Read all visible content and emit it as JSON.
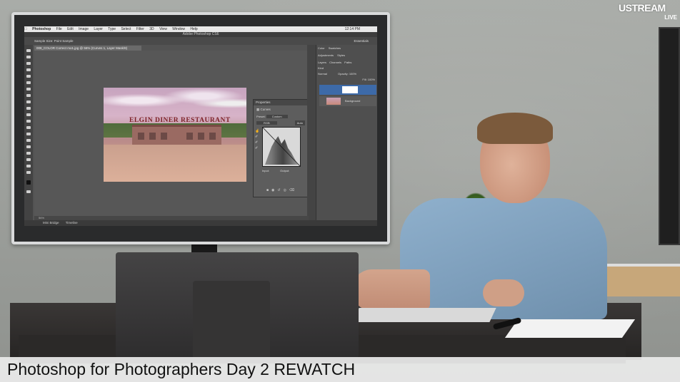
{
  "overlay": {
    "banner_title": "Photoshop for Photographers Day 2 REWATCH",
    "logo": {
      "name": "USTREAM",
      "sub": "LIVE"
    }
  },
  "photoshop": {
    "menu": [
      "Photoshop",
      "File",
      "Edit",
      "Image",
      "Layer",
      "Type",
      "Select",
      "Filter",
      "3D",
      "View",
      "Window",
      "Help"
    ],
    "clock": "12:14 PM",
    "window_title": "Adobe Photoshop CS6",
    "options_bar": "Sample Size:  Point Sample",
    "workspace": "Essentials",
    "document_tab": "008_COLOR Correct mo1.jpg @ 56% (Curves 1, Layer Mask/8)",
    "zoom_status": "56%",
    "bottom_tabs": [
      "Mini Bridge",
      "Timeline"
    ],
    "properties_panel": {
      "title": "Properties",
      "adjustment": "Curves",
      "preset_label": "Preset:",
      "preset_value": "Custom",
      "channel": "RGB",
      "auto_label": "Auto",
      "input_label": "Input:",
      "output_label": "Output:"
    },
    "layers_panel": {
      "tabs": [
        "Layers",
        "Channels",
        "Paths"
      ],
      "blend_mode": "Normal",
      "opacity_label": "Opacity:",
      "opacity_value": "100%",
      "fill_label": "Fill:",
      "fill_value": "100%",
      "kind": "Kind",
      "background_layer": "Background"
    },
    "adjustments_tabs": [
      "Adjustments",
      "Styles"
    ],
    "color_tabs": [
      "Color",
      "Swatches"
    ]
  },
  "photo": {
    "sign_text": "ELGIN DINER RESTAURANT"
  }
}
